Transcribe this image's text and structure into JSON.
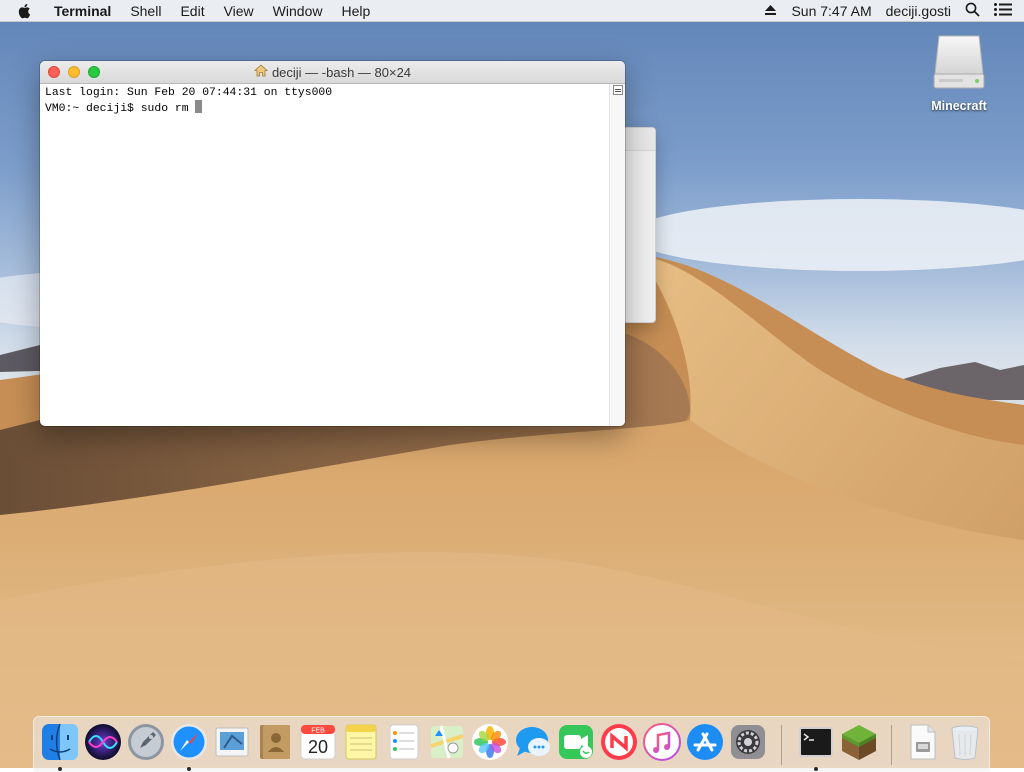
{
  "menubar": {
    "apple_icon": "apple-logo-icon",
    "app_name": "Terminal",
    "menus": [
      "Shell",
      "Edit",
      "View",
      "Window",
      "Help"
    ],
    "clock": "Sun 7:47 AM",
    "user": "deciji.gosti",
    "icons": [
      "eject-icon",
      "spotlight-icon",
      "notification-center-icon"
    ]
  },
  "terminal": {
    "title": "deciji — -bash — 80×24",
    "lines": [
      "Last login: Sun Feb 20 07:44:31 on ttys000",
      "VM0:~ deciji$ sudo rm "
    ]
  },
  "desktop": {
    "icons": [
      {
        "label": "Minecraft",
        "icon": "disk-drive-icon"
      }
    ]
  },
  "dock": {
    "items": [
      {
        "name": "Finder",
        "icon": "finder-icon",
        "running": true
      },
      {
        "name": "Siri",
        "icon": "siri-icon",
        "running": false
      },
      {
        "name": "Launchpad",
        "icon": "launchpad-icon",
        "running": false
      },
      {
        "name": "Safari",
        "icon": "safari-icon",
        "running": true
      },
      {
        "name": "Mail",
        "icon": "mail-icon",
        "running": false
      },
      {
        "name": "Contacts",
        "icon": "contacts-icon",
        "running": false
      },
      {
        "name": "Calendar",
        "icon": "calendar-icon",
        "running": false,
        "month": "FEB",
        "day": "20"
      },
      {
        "name": "Notes",
        "icon": "notes-icon",
        "running": false
      },
      {
        "name": "Reminders",
        "icon": "reminders-icon",
        "running": false
      },
      {
        "name": "Maps",
        "icon": "maps-icon",
        "running": false
      },
      {
        "name": "Photos",
        "icon": "photos-icon",
        "running": false
      },
      {
        "name": "Messages",
        "icon": "messages-icon",
        "running": false
      },
      {
        "name": "FaceTime",
        "icon": "facetime-icon",
        "running": false
      },
      {
        "name": "News",
        "icon": "news-icon",
        "running": false
      },
      {
        "name": "iTunes",
        "icon": "itunes-icon",
        "running": false
      },
      {
        "name": "App Store",
        "icon": "app-store-icon",
        "running": false
      },
      {
        "name": "System Preferences",
        "icon": "system-preferences-icon",
        "running": false
      },
      {
        "name": "Terminal",
        "icon": "terminal-icon",
        "running": true
      },
      {
        "name": "Minecraft",
        "icon": "minecraft-icon",
        "running": false
      },
      {
        "name": "Document",
        "icon": "document-icon",
        "running": false
      },
      {
        "name": "Trash",
        "icon": "trash-icon",
        "running": false
      }
    ]
  },
  "colors": {
    "close": "#fc5f57",
    "minimize": "#fdbc2e",
    "maximize": "#28c840",
    "sand": "#d9a86a"
  }
}
